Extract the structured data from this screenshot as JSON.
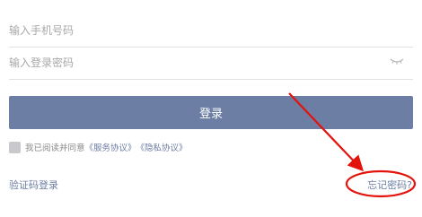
{
  "form": {
    "phone_placeholder": "输入手机号码",
    "password_placeholder": "输入登录密码",
    "login_label": "登录",
    "agree_text": "我已阅读并同意",
    "service_agreement": "《服务协议》",
    "privacy_agreement": "《隐私协议》",
    "sms_login_label": "验证码登录",
    "forgot_password_label": "忘记密码?"
  },
  "icons": {
    "password_toggle": "eye-closed-icon"
  },
  "colors": {
    "accent": "#6c7ea4",
    "annotation": "#e3120b"
  }
}
